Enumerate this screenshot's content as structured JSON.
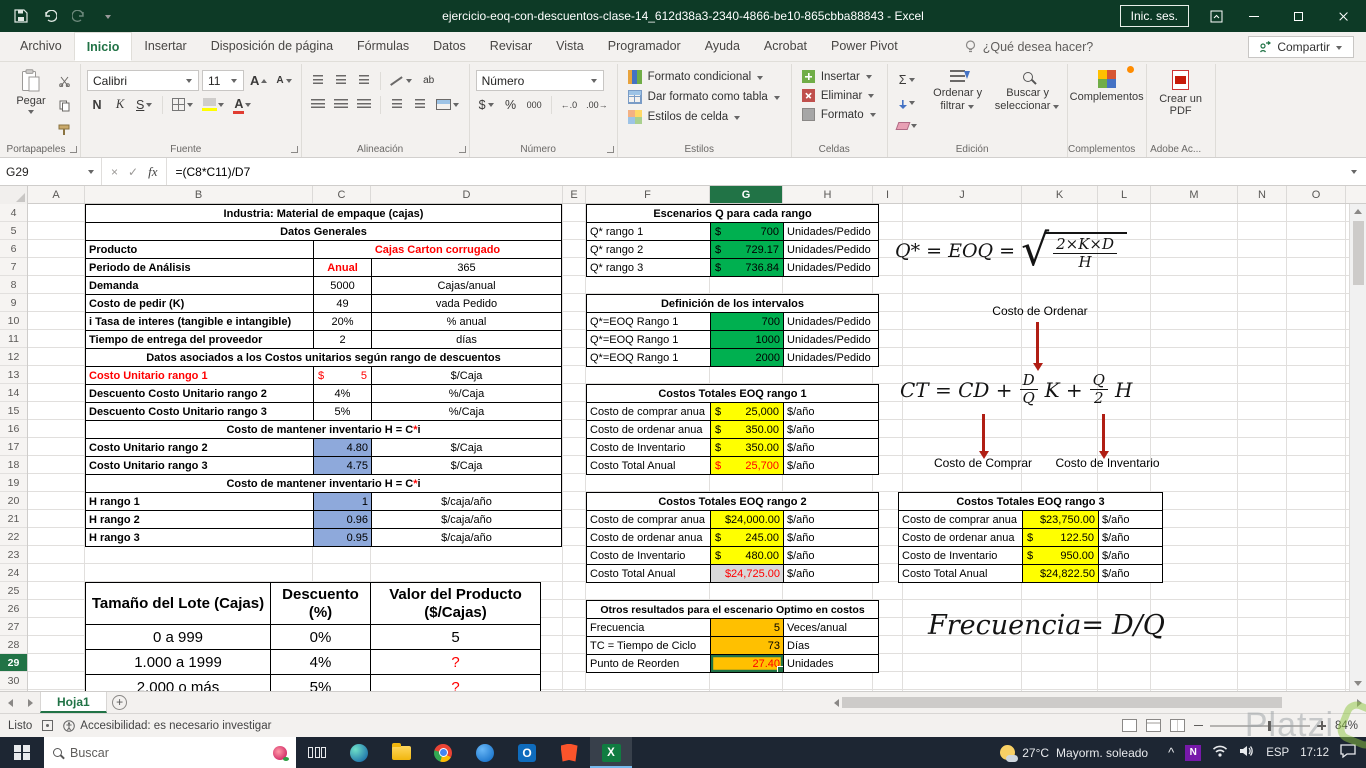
{
  "window": {
    "title": "ejercicio-eoq-con-descuentos-clase-14_612d38a3-2340-4866-be10-865cbba88843 - Excel",
    "sign_in": "Inic. ses."
  },
  "ribbon": {
    "tabs": [
      "Archivo",
      "Inicio",
      "Insertar",
      "Disposición de página",
      "Fórmulas",
      "Datos",
      "Revisar",
      "Vista",
      "Programador",
      "Ayuda",
      "Acrobat",
      "Power Pivot"
    ],
    "active_tab_index": 1,
    "search_hint": "¿Qué desea hacer?",
    "share_label": "Compartir",
    "clipboard": {
      "label": "Portapapeles",
      "paste": "Pegar"
    },
    "font": {
      "label": "Fuente",
      "name": "Calibri",
      "size": "11",
      "bold": "N",
      "italic": "K",
      "underline": "S",
      "grow": "A",
      "shrink": "A",
      "color_letter": "A"
    },
    "alignment": {
      "label": "Alineación",
      "wrap": "ab"
    },
    "number": {
      "label": "Número",
      "format": "Número",
      "accounting": "$",
      "percent": "%",
      "comma": "000",
      "inc_decimal": "←.0",
      "dec_decimal": ".00→"
    },
    "styles": {
      "label": "Estilos",
      "conditional": "Formato condicional",
      "table": "Dar formato como tabla",
      "cell": "Estilos de celda"
    },
    "cells": {
      "label": "Celdas",
      "insert": "Insertar",
      "del": "Eliminar",
      "format": "Formato"
    },
    "editing": {
      "label": "Edición",
      "autosum": "Σ",
      "sort": "Ordenar y filtrar",
      "find": "Buscar y seleccionar"
    },
    "addins": {
      "label": "Complementos",
      "button": "Complementos"
    },
    "adobe": {
      "label": "Adobe Ac...",
      "button": "Crear un PDF"
    }
  },
  "formula_bar": {
    "name_box": "G29",
    "cancel": "×",
    "enter": "✓",
    "fx": "fx",
    "formula": "=(C8*C11)/D7"
  },
  "grid": {
    "columns": [
      "A",
      "B",
      "C",
      "D",
      "E",
      "F",
      "G",
      "H",
      "I",
      "J",
      "K",
      "L",
      "M",
      "N",
      "O"
    ],
    "selected_column": "G",
    "row_start": 4,
    "row_end": 30,
    "selected_row": 29
  },
  "tables": {
    "general": {
      "rows": [
        [
          {
            "t": "Industria: Material de empaque (cajas)",
            "span": 3,
            "a": "c",
            "b": 1
          }
        ],
        [
          {
            "t": "Datos Generales",
            "span": 3,
            "a": "c",
            "b": 1
          }
        ],
        [
          {
            "t": "Producto",
            "b": 1
          },
          {
            "t": "Cajas Carton corrugado",
            "span": 2,
            "a": "c",
            "b": 1,
            "red": 1
          }
        ],
        [
          {
            "t": "Periodo de Análisis",
            "b": 1
          },
          {
            "t": "Anual",
            "a": "c",
            "b": 1,
            "red": 1
          },
          {
            "t": "365",
            "a": "c"
          }
        ],
        [
          {
            "t": "Demanda",
            "b": 1
          },
          {
            "t": "5000",
            "a": "c"
          },
          {
            "t": "Cajas/anual",
            "a": "c"
          }
        ],
        [
          {
            "t": "Costo de pedir (K)",
            "b": 1
          },
          {
            "t": "49",
            "a": "c"
          },
          {
            "t": "vada Pedido",
            "a": "c"
          }
        ],
        [
          {
            "t": "i Tasa de interes (tangible e intangible)",
            "b": 1
          },
          {
            "t": "20%",
            "a": "c"
          },
          {
            "t": "% anual",
            "a": "c"
          }
        ],
        [
          {
            "t": "Tiempo de entrega del proveedor",
            "b": 1
          },
          {
            "t": "2",
            "a": "c"
          },
          {
            "t": "días",
            "a": "c"
          }
        ],
        [
          {
            "t": "Datos asociados a los Costos unitarios según rango de descuentos",
            "span": 3,
            "a": "c",
            "b": 1
          }
        ],
        [
          {
            "t": "Costo Unitario rango 1",
            "b": 1,
            "red": 1
          },
          {
            "cur": "$",
            "t": "5",
            "red": 1
          },
          {
            "t": "$/Caja",
            "a": "c"
          }
        ],
        [
          {
            "t": "Descuento Costo Unitario rango 2",
            "b": 1
          },
          {
            "t": "4%",
            "a": "c"
          },
          {
            "t": "%/Caja",
            "a": "c"
          }
        ],
        [
          {
            "t": "Descuento Costo Unitario rango 3",
            "b": 1
          },
          {
            "t": "5%",
            "a": "c"
          },
          {
            "t": "%/Caja",
            "a": "c"
          }
        ],
        [
          {
            "t": "Costo de mantener inventario H = C*i",
            "span": 3,
            "a": "c",
            "b": 1,
            "rs": 1
          }
        ],
        [
          {
            "t": "Costo Unitario rango 2",
            "b": 1
          },
          {
            "t": "4.80",
            "a": "r",
            "fill": "blue"
          },
          {
            "t": "$/Caja",
            "a": "c"
          }
        ],
        [
          {
            "t": "Costo Unitario rango 3",
            "b": 1
          },
          {
            "t": "4.75",
            "a": "r",
            "fill": "blue"
          },
          {
            "t": "$/Caja",
            "a": "c"
          }
        ],
        [
          {
            "t": "Costo de mantener inventario H = C*i",
            "span": 3,
            "a": "c",
            "b": 1,
            "rs": 1
          }
        ],
        [
          {
            "t": "H rango 1",
            "b": 1
          },
          {
            "t": "1",
            "a": "r",
            "fill": "blue"
          },
          {
            "t": "$/caja/año",
            "a": "c"
          }
        ],
        [
          {
            "t": "H rango 2",
            "b": 1
          },
          {
            "t": "0.96",
            "a": "r",
            "fill": "blue"
          },
          {
            "t": "$/caja/año",
            "a": "c"
          }
        ],
        [
          {
            "t": "H rango 3",
            "b": 1
          },
          {
            "t": "0.95",
            "a": "r",
            "fill": "blue"
          },
          {
            "t": "$/caja/año",
            "a": "c"
          }
        ]
      ]
    },
    "escenarios": {
      "title": "Escenarios Q para cada rango",
      "rows": [
        [
          {
            "t": "Q* rango 1"
          },
          {
            "cur": "$",
            "t": "700",
            "fill": "green"
          },
          {
            "t": "Unidades/Pedido"
          }
        ],
        [
          {
            "t": "Q* rango 2"
          },
          {
            "cur": "$",
            "t": "729.17",
            "fill": "green"
          },
          {
            "t": "Unidades/Pedido"
          }
        ],
        [
          {
            "t": "Q* rango 3"
          },
          {
            "cur": "$",
            "t": "736.84",
            "fill": "green"
          },
          {
            "t": "Unidades/Pedido"
          }
        ]
      ]
    },
    "definicion": {
      "title": "Definición de los intervalos",
      "rows": [
        [
          {
            "t": "Q*=EOQ Rango 1"
          },
          {
            "t": "700",
            "a": "r",
            "fill": "green"
          },
          {
            "t": "Unidades/Pedido"
          }
        ],
        [
          {
            "t": "Q*=EOQ Rango 1"
          },
          {
            "t": "1000",
            "a": "r",
            "fill": "green"
          },
          {
            "t": "Unidades/Pedido"
          }
        ],
        [
          {
            "t": "Q*=EOQ Rango 1"
          },
          {
            "t": "2000",
            "a": "r",
            "fill": "green"
          },
          {
            "t": "Unidades/Pedido"
          }
        ]
      ]
    },
    "costos1": {
      "title": "Costos Totales EOQ rango 1",
      "rows": [
        [
          {
            "t": "Costo de comprar anua"
          },
          {
            "cur": "$",
            "t": "25,000",
            "fill": "yellow"
          },
          {
            "t": "$/año"
          }
        ],
        [
          {
            "t": "Costo de ordenar anua"
          },
          {
            "cur": "$",
            "t": "350.00",
            "fill": "yellow"
          },
          {
            "t": "$/año"
          }
        ],
        [
          {
            "t": "Costo de Inventario"
          },
          {
            "cur": "$",
            "t": "350.00",
            "fill": "yellow"
          },
          {
            "t": "$/año"
          }
        ],
        [
          {
            "t": "Costo Total Anual"
          },
          {
            "cur": "$",
            "t": "25,700",
            "fill": "yellow",
            "red": 1
          },
          {
            "t": "$/año"
          }
        ]
      ]
    },
    "costos2": {
      "title": "Costos Totales EOQ rango 2",
      "rows": [
        [
          {
            "t": "Costo de comprar anua"
          },
          {
            "t": "$24,000.00",
            "a": "r",
            "fill": "yellow"
          },
          {
            "t": "$/año"
          }
        ],
        [
          {
            "t": "Costo de ordenar anua"
          },
          {
            "cur": "$",
            "t": "245.00",
            "fill": "yellow"
          },
          {
            "t": "$/año"
          }
        ],
        [
          {
            "t": "Costo de Inventario"
          },
          {
            "cur": "$",
            "t": "480.00",
            "fill": "yellow"
          },
          {
            "t": "$/año"
          }
        ],
        [
          {
            "t": "Costo Total Anual"
          },
          {
            "t": "$24,725.00",
            "a": "r",
            "fill": "gray",
            "red": 1
          },
          {
            "t": "$/año"
          }
        ]
      ]
    },
    "costos3": {
      "title": "Costos Totales EOQ rango 3",
      "rows": [
        [
          {
            "t": "Costo de comprar anua"
          },
          {
            "t": "$23,750.00",
            "a": "r",
            "fill": "yellow"
          },
          {
            "t": "$/año"
          }
        ],
        [
          {
            "t": "Costo de ordenar anua"
          },
          {
            "cur": "$",
            "t": "122.50",
            "fill": "yellow"
          },
          {
            "t": "$/año"
          }
        ],
        [
          {
            "t": "Costo de Inventario"
          },
          {
            "cur": "$",
            "t": "950.00",
            "fill": "yellow"
          },
          {
            "t": "$/año"
          }
        ],
        [
          {
            "t": "Costo Total Anual"
          },
          {
            "t": "$24,822.50",
            "a": "r",
            "fill": "yellow"
          },
          {
            "t": "$/año"
          }
        ]
      ]
    },
    "otros": {
      "title": "Otros resultados para el escenario Optimo en costos",
      "rows": [
        [
          {
            "t": "Frecuencia"
          },
          {
            "t": "5",
            "a": "r",
            "fill": "orange"
          },
          {
            "t": "Veces/anual"
          }
        ],
        [
          {
            "t": "TC = Tiempo de Ciclo"
          },
          {
            "t": "73",
            "a": "r",
            "fill": "orange"
          },
          {
            "t": "Días"
          }
        ],
        [
          {
            "t": "Punto de Reorden"
          },
          {
            "t": "27.40",
            "a": "r",
            "fill": "orange",
            "red": 1,
            "sel": 1
          },
          {
            "t": "Unidades"
          }
        ]
      ]
    },
    "discount": {
      "head": [
        "Tamaño del Lote (Cajas)",
        "Descuento (%)",
        "Valor del Producto ($/Cajas)"
      ],
      "rows": [
        [
          {
            "t": "0 a 999",
            "a": "c"
          },
          {
            "t": "0%",
            "a": "c"
          },
          {
            "t": "5",
            "a": "c"
          }
        ],
        [
          {
            "t": "1.000 a 1999",
            "a": "c"
          },
          {
            "t": "4%",
            "a": "c"
          },
          {
            "t": "?",
            "a": "c",
            "red": 1
          }
        ],
        [
          {
            "t": "2.000 o más",
            "a": "c"
          },
          {
            "t": "5%",
            "a": "c"
          },
          {
            "t": "?",
            "a": "c",
            "red": 1
          }
        ]
      ]
    }
  },
  "math": {
    "eoq": {
      "lhs": "Q* = EOQ =",
      "radical": "√",
      "num": "2×K×D",
      "den": "H"
    },
    "ordenar": "Costo de Ordenar",
    "ct": {
      "p1": "CT = CD +",
      "f1n": "D",
      "f1d": "Q",
      "p2": "K +",
      "f2n": "Q",
      "f2d": "2",
      "p3": "H"
    },
    "comprar": "Costo de Comprar",
    "inventario": "Costo de Inventario",
    "freq": {
      "lhs": "Frecuencia=",
      "frac": "D/Q"
    }
  },
  "sheet": {
    "tab": "Hoja1"
  },
  "status": {
    "mode": "Listo",
    "accessibility": "Accesibilidad: es necesario investigar",
    "zoom": "84%"
  },
  "taskbar": {
    "search_placeholder": "Buscar",
    "weather_temp": "27°C",
    "weather_desc": "Mayorm. soleado",
    "lang": "ESP",
    "time": "17:12"
  },
  "watermark": {
    "text": "Platzi"
  }
}
